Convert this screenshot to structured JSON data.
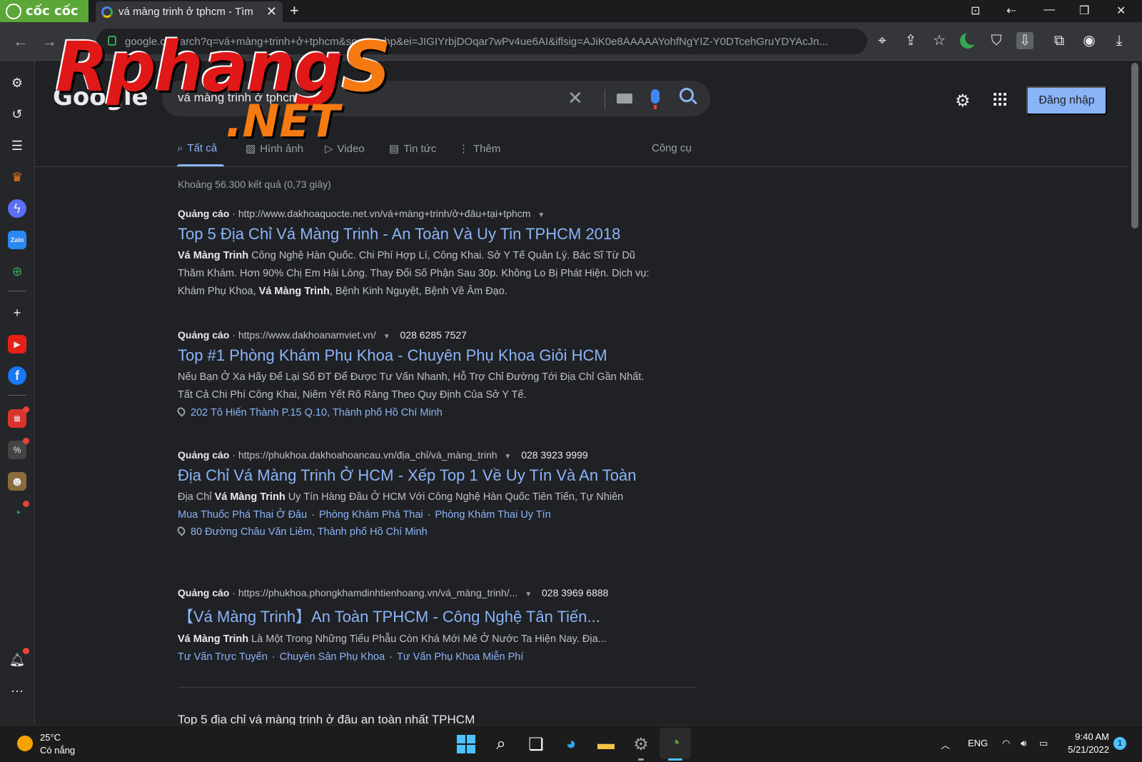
{
  "browser": {
    "brand": "cốc cốc",
    "tab_title": "vá màng trinh ở tphcm - Tìm",
    "url": "google.c/search?q=vá+màng+trinh+ở+tphcm&source=hp&ei=JIGIYrbjDOqar7wPv4ue6AI&iflsig=AJiK0e8AAAAAYohfNgYIZ-Y0DTcehGruYDYAcJn..."
  },
  "watermark": {
    "main": "Rphang",
    "main_tail": "S",
    "sub": ".NET"
  },
  "google": {
    "logo": "Google",
    "query": "vá màng trinh ở tphcm",
    "signin": "Đăng nhập",
    "tabs": [
      {
        "label": "Tất cả"
      },
      {
        "label": "Hình ảnh"
      },
      {
        "label": "Video"
      },
      {
        "label": "Tin tức"
      },
      {
        "label": "Thêm"
      }
    ],
    "tools": "Công cụ",
    "stats": "Khoảng 56.300 kết quả (0,73 giây)",
    "ad_label": "Quảng cáo",
    "results": [
      {
        "url": "http://www.dakhoaquocte.net.vn/vá+màng+trinh/ở+đâu+tại+tphcm",
        "phone": "",
        "title": "Top 5 Địa Chỉ Vá Màng Trinh - An Toàn Và Uy Tin TPHCM 2018",
        "snippet_bold1": "Vá Màng Trinh",
        "snippet_part1": " Công Nghệ Hàn Quốc. Chi Phí Hợp Lí, Công Khai. Sở Y Tế Quản Lý. Bác Sĩ Từ Dũ Thăm Khám. Hơn 90% Chị Em Hài Lòng. Thay Đổi Số Phận Sau 30p. Không Lo Bị Phát Hiện. Dịch vụ: Khám Phụ Khoa, ",
        "snippet_bold2": "Vá Màng Trinh",
        "snippet_part2": ", Bệnh Kinh Nguyệt, Bệnh Về Âm Đạo."
      },
      {
        "url": "https://www.dakhoanamviet.vn/",
        "phone": "028 6285 7527",
        "title": "Top #1 Phòng Khám Phụ Khoa - Chuyên Phụ Khoa Giỏi HCM",
        "snippet": "Nếu Bạn Ở Xa Hãy Để Lại Số ĐT Để Được Tư Vấn Nhanh, Hỗ Trợ Chỉ Đường Tới Địa Chỉ Gần Nhất. Tất Cả Chi Phí Công Khai, Niêm Yết Rõ Ràng Theo Quy Định Của Sở Y Tế.",
        "address": "202 Tô Hiến Thành P.15 Q.10, Thành phố Hồ Chí Minh"
      },
      {
        "url": "https://phukhoa.dakhoahoancau.vn/địa_chỉ/vá_màng_trinh",
        "phone": "028 3923 9999",
        "title": "Địa Chỉ Vá Màng Trinh Ở HCM - Xếp Top 1 Về Uy Tín Và An Toàn",
        "snippet_pre": "Địa Chỉ ",
        "snippet_bold": "Vá Màng Trinh",
        "snippet_post": " Uy Tín Hàng Đầu Ở HCM Với Công Nghệ Hàn Quốc Tiên Tiến, Tự Nhiên",
        "sitelinks": [
          "Mua Thuốc Phá Thai Ở Đâu",
          "Phòng Khám Phá Thai",
          "Phòng Khám Thai Uy Tín"
        ],
        "address": "80 Đường Châu Văn Liêm, Thành phố Hồ Chí Minh"
      },
      {
        "url": "https://phukhoa.phongkhamdinhtienhoang.vn/vá_màng_trinh/...",
        "phone": "028 3969 6888",
        "title": "【Vá Màng Trinh】An Toàn TPHCM - Công Nghệ Tân Tiến...",
        "snippet_bold": "Vá Màng Trinh",
        "snippet_post": " Là Một Trong Những Tiểu Phẫu Còn Khá Mới Mẻ Ở Nước Ta Hiện Nay. Địa...",
        "sitelinks": [
          "Tư Vấn Trực Tuyến",
          "Chuyên Sản Phụ Khoa",
          "Tư Vấn Phụ Khoa Miễn Phí"
        ]
      }
    ],
    "next_heading": "Top 5 địa chỉ vá màng trinh ở đâu an toàn nhất TPHCM"
  },
  "taskbar": {
    "temp": "25°C",
    "weather": "Có nắng",
    "lang": "ENG",
    "time": "9:40 AM",
    "date": "5/21/2022",
    "notif_count": "1"
  },
  "colors": {
    "background": "#202124",
    "link": "#8ab4f8",
    "brand_green": "#5aa637",
    "signin_button": "#8ab4f8"
  }
}
